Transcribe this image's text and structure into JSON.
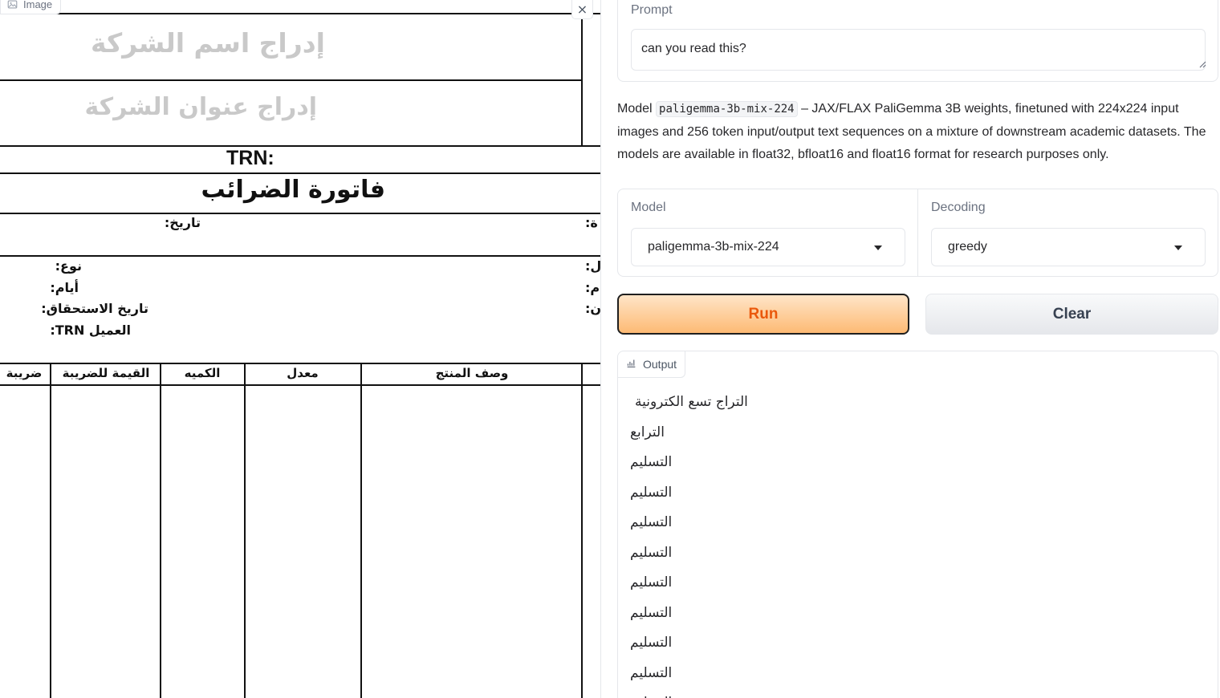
{
  "image_panel": {
    "label": "Image",
    "close_symbol": "×",
    "document": {
      "company_name_placeholder": "إدراج اسم الشركة",
      "company_address_placeholder": "إدراج عنوان الشركة",
      "trn_label": "TRN:",
      "invoice_title": "فاتورة الضرائب",
      "date_label": "تاريخ:",
      "right_edge_label_1": ":ة",
      "type_label": "نوع:",
      "days_label": "أيام:",
      "due_date_label": "تاريخ الاستحقاق:",
      "customer_trn_label": "العميل TRN:",
      "right_edge_label_2": ":ل",
      "right_edge_label_3": ":م",
      "right_edge_label_4": ":ن",
      "columns": [
        "ضريبة",
        "القيمة للضريبة",
        "الكميه",
        "معدل",
        "وصف المنتج"
      ]
    }
  },
  "prompt": {
    "label": "Prompt",
    "value": "can you read this?"
  },
  "model_description": {
    "prefix": "Model",
    "model_code": "paligemma-3b-mix-224",
    "text": "– JAX/FLAX PaliGemma 3B weights, finetuned with 224x224 input images and 256 token input/output text sequences on a mixture of downstream academic datasets. The models are available in float32, bfloat16 and float16 format for research purposes only."
  },
  "settings": {
    "model_label": "Model",
    "model_value": "paligemma-3b-mix-224",
    "decoding_label": "Decoding",
    "decoding_value": "greedy"
  },
  "buttons": {
    "run": "Run",
    "clear": "Clear"
  },
  "output": {
    "label": "Output",
    "lines": [
      "التراج تسع الكترونية",
      "الترابع",
      "التسليم",
      "التسليم",
      "التسليم",
      "التسليم",
      "التسليم",
      "التسليم",
      "التسليم",
      "التسليم",
      "التسليم"
    ]
  },
  "icons": {
    "image_tag": "image-icon",
    "output_tag": "chart-icon",
    "close": "close-icon",
    "dropdown": "caret-down-icon"
  },
  "colors": {
    "run_text": "#ea580c",
    "run_gradient_top": "#ffe5c8",
    "run_gradient_bottom": "#fdba74",
    "border": "#e5e7eb",
    "label": "#6b7280"
  }
}
